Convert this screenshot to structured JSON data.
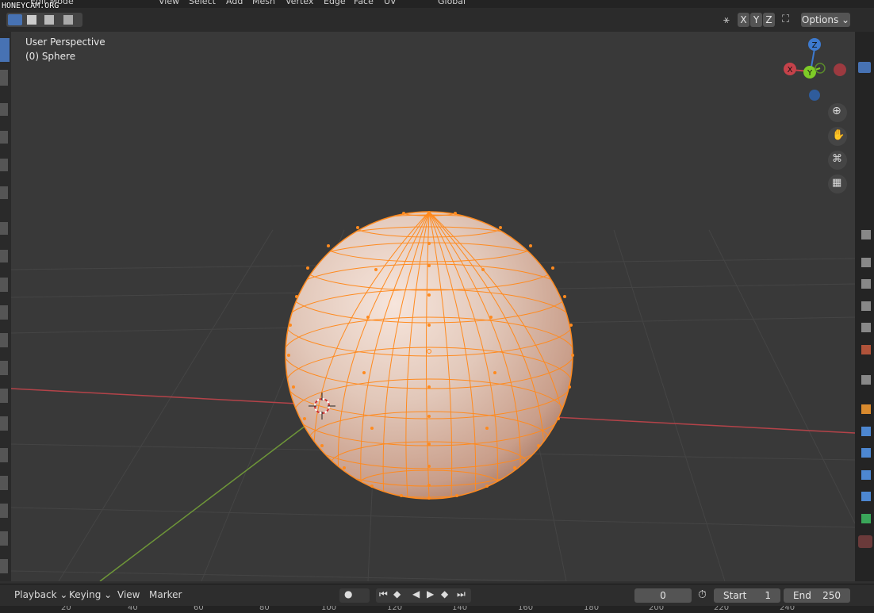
{
  "watermark": "HONEYCAM.ORG",
  "header": {
    "mode_label": "Edit Mode",
    "menus": [
      "View",
      "Select",
      "Add",
      "Mesh",
      "Vertex",
      "Edge",
      "Face",
      "UV"
    ],
    "orientation": "Global"
  },
  "viewport_header": {
    "axes": [
      "X",
      "Y",
      "Z"
    ],
    "options_label": "Options"
  },
  "viewport": {
    "perspective_label": "User Perspective",
    "object_label": "(0) Sphere",
    "gizmo": {
      "x": "X",
      "y": "Y",
      "z": "Z"
    }
  },
  "timeline": {
    "playback": "Playback",
    "keying": "Keying",
    "view": "View",
    "marker": "Marker",
    "current_frame": "0",
    "start_label": "Start",
    "start_value": "1",
    "end_label": "End",
    "end_value": "250"
  },
  "ruler_ticks": [
    "20",
    "40",
    "60",
    "80",
    "100",
    "120",
    "140",
    "160",
    "180",
    "200",
    "220",
    "240"
  ],
  "colors": {
    "selection": "#ff8a1e",
    "axis_x": "#c6424a",
    "axis_y": "#7ba23c",
    "gizmo_z": "#3d7acf",
    "gizmo_y": "#7ecb27"
  }
}
